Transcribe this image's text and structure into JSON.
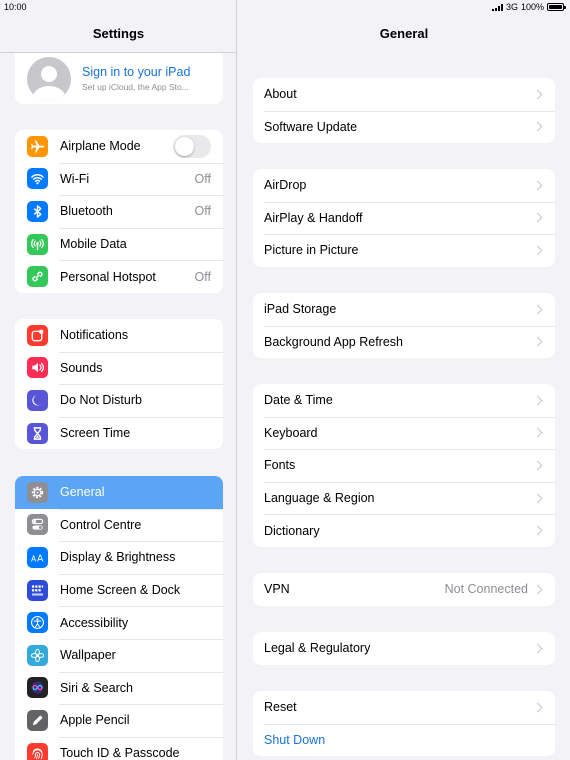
{
  "status": {
    "time": "10:00",
    "network": "3G",
    "battery": "100%"
  },
  "master": {
    "title": "Settings",
    "profile": {
      "title": "Sign in to your iPad",
      "subtitle": "Set up iCloud, the App Sto..."
    },
    "groups": [
      [
        {
          "label": "Airplane Mode",
          "icon": "airplane-icon",
          "color": "#ff9500",
          "control": "toggle",
          "toggle_on": false
        },
        {
          "label": "Wi-Fi",
          "icon": "wifi-icon",
          "color": "#007aff",
          "value": "Off"
        },
        {
          "label": "Bluetooth",
          "icon": "bluetooth-icon",
          "color": "#007aff",
          "value": "Off"
        },
        {
          "label": "Mobile Data",
          "icon": "antenna-icon",
          "color": "#34c759"
        },
        {
          "label": "Personal Hotspot",
          "icon": "hotspot-icon",
          "color": "#34c759",
          "value": "Off"
        }
      ],
      [
        {
          "label": "Notifications",
          "icon": "notifications-icon",
          "color": "#ff3b30"
        },
        {
          "label": "Sounds",
          "icon": "speaker-icon",
          "color": "#ff2d55"
        },
        {
          "label": "Do Not Disturb",
          "icon": "moon-icon",
          "color": "#5856d6"
        },
        {
          "label": "Screen Time",
          "icon": "hourglass-icon",
          "color": "#5856d6"
        }
      ],
      [
        {
          "label": "General",
          "icon": "gear-icon",
          "color": "#8e8e93",
          "selected": true
        },
        {
          "label": "Control Centre",
          "icon": "switches-icon",
          "color": "#8e8e93"
        },
        {
          "label": "Display & Brightness",
          "icon": "text-size-icon",
          "color": "#007aff"
        },
        {
          "label": "Home Screen & Dock",
          "icon": "grid-icon",
          "color": "#2c4bd6"
        },
        {
          "label": "Accessibility",
          "icon": "accessibility-icon",
          "color": "#007aff"
        },
        {
          "label": "Wallpaper",
          "icon": "flower-icon",
          "color": "#34aadc"
        },
        {
          "label": "Siri & Search",
          "icon": "siri-icon",
          "color": "#222222"
        },
        {
          "label": "Apple Pencil",
          "icon": "pencil-icon",
          "color": "#636366"
        },
        {
          "label": "Touch ID & Passcode",
          "icon": "fingerprint-icon",
          "color": "#ff3b30"
        }
      ]
    ]
  },
  "detail": {
    "title": "General",
    "groups": [
      [
        {
          "label": "About"
        },
        {
          "label": "Software Update"
        }
      ],
      [
        {
          "label": "AirDrop"
        },
        {
          "label": "AirPlay & Handoff"
        },
        {
          "label": "Picture in Picture"
        }
      ],
      [
        {
          "label": "iPad Storage"
        },
        {
          "label": "Background App Refresh"
        }
      ],
      [
        {
          "label": "Date & Time"
        },
        {
          "label": "Keyboard"
        },
        {
          "label": "Fonts"
        },
        {
          "label": "Language & Region"
        },
        {
          "label": "Dictionary"
        }
      ],
      [
        {
          "label": "VPN",
          "value": "Not Connected"
        }
      ],
      [
        {
          "label": "Legal & Regulatory"
        }
      ],
      [
        {
          "label": "Reset"
        },
        {
          "label": "Shut Down",
          "link": true,
          "no_chevron": true
        }
      ]
    ]
  }
}
